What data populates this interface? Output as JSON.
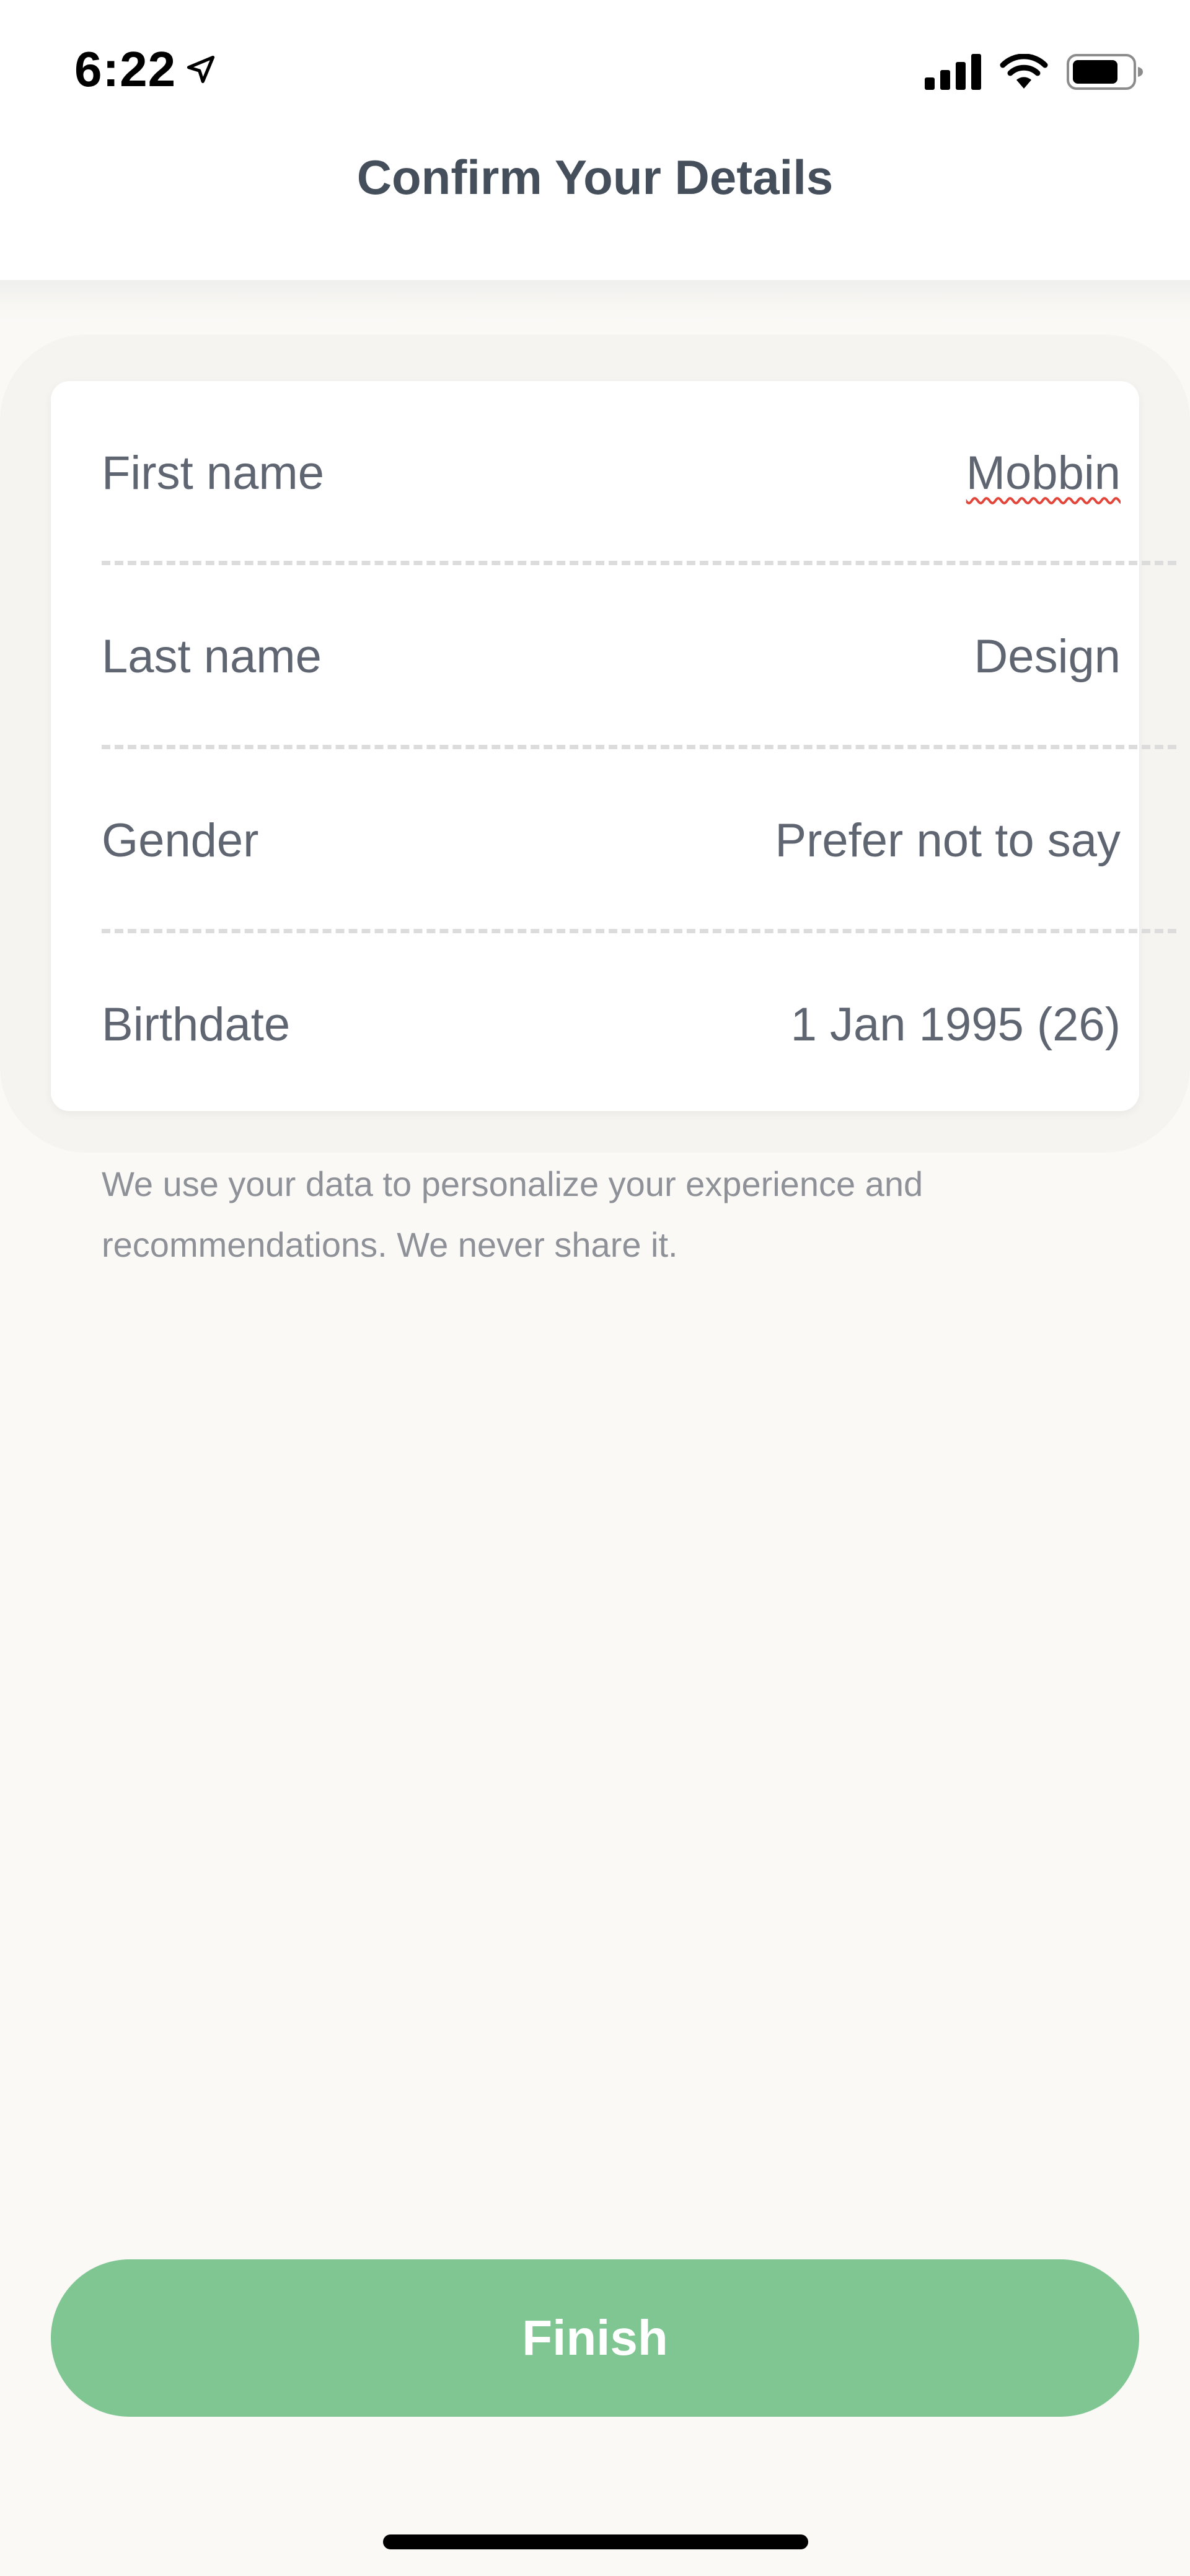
{
  "status_bar": {
    "time": "6:22",
    "location_icon": "location-arrow-icon",
    "signal_icon": "cellular-signal-icon",
    "wifi_icon": "wifi-icon",
    "battery_icon": "battery-icon"
  },
  "header": {
    "title": "Confirm Your Details"
  },
  "details": [
    {
      "label": "First name",
      "value": "Mobbin"
    },
    {
      "label": "Last name",
      "value": "Design"
    },
    {
      "label": "Gender",
      "value": "Prefer not to say"
    },
    {
      "label": "Birthdate",
      "value": "1 Jan 1995 (26)"
    }
  ],
  "note": "We use your data to personalize your experience and recommendations. We never share it.",
  "finish_button": {
    "label": "Finish"
  },
  "colors": {
    "accent": "#7fc692",
    "title": "#454e5b",
    "background": "#faf9f6"
  }
}
